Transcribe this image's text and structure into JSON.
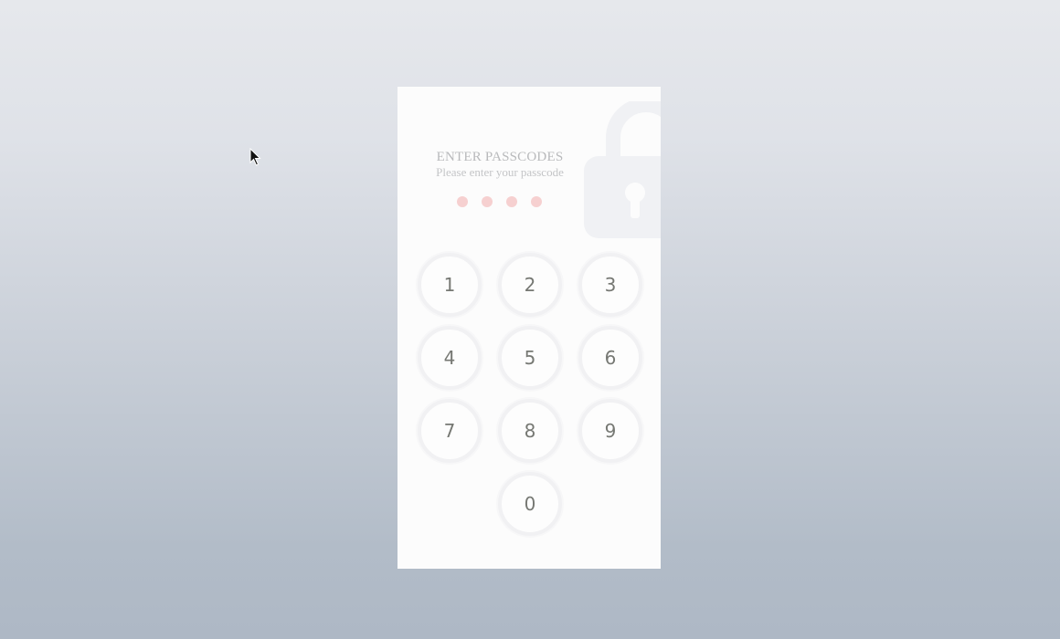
{
  "passcode_screen": {
    "title": "ENTER PASSCODES",
    "subtitle": "Please enter your passcode",
    "digit_count": 4,
    "entered_digits": 0
  },
  "keypad": {
    "keys": [
      "1",
      "2",
      "3",
      "4",
      "5",
      "6",
      "7",
      "8",
      "9",
      "0"
    ]
  },
  "icons": {
    "background": "padlock-open-icon",
    "pointer": "mouse-cursor-icon"
  },
  "colors": {
    "panel_background": "#fcfcfc",
    "indicator_dot": "#f6d0d0",
    "key_digit": "#767873",
    "key_ring": "#f1f1f3"
  }
}
